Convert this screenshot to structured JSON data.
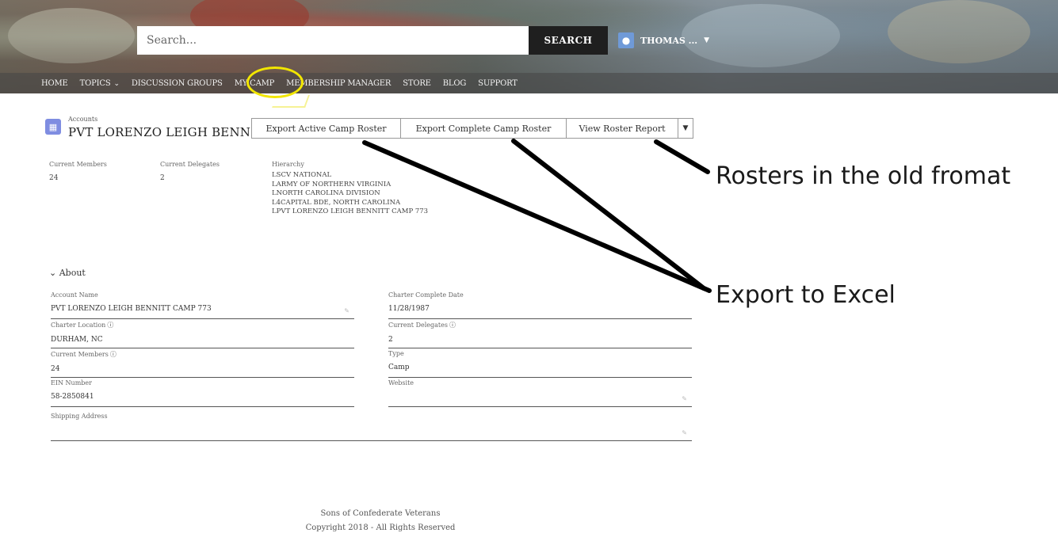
{
  "header": {
    "search_placeholder": "Search...",
    "search_button": "SEARCH",
    "user_name": "THOMAS ...",
    "nav": [
      {
        "label": "HOME"
      },
      {
        "label": "TOPICS",
        "has_dropdown": true
      },
      {
        "label": "DISCUSSION GROUPS"
      },
      {
        "label": "MY CAMP"
      },
      {
        "label": "MEMBERSHIP MANAGER"
      },
      {
        "label": "STORE"
      },
      {
        "label": "BLOG"
      },
      {
        "label": "SUPPORT"
      }
    ],
    "highlight_color": "#f2e600"
  },
  "record": {
    "object_label": "Accounts",
    "title": "PVT LORENZO LEIGH BENNIT...",
    "actions": {
      "export_active": "Export Active Camp Roster",
      "export_complete": "Export Complete Camp Roster",
      "view_roster": "View Roster Report",
      "more_icon": "chevron-down-icon"
    }
  },
  "highlights": {
    "current_members_label": "Current Members",
    "current_members_value": "24",
    "current_delegates_label": "Current Delegates",
    "current_delegates_value": "2",
    "hierarchy_label": "Hierarchy",
    "hierarchy": [
      "LSCV NATIONAL",
      "LARMY OF NORTHERN VIRGINIA",
      "LNORTH CAROLINA DIVISION",
      "L4CAPITAL BDE, NORTH CAROLINA",
      "LPVT LORENZO LEIGH BENNITT CAMP 773"
    ]
  },
  "about": {
    "heading": "About",
    "fields": {
      "account_name": {
        "label": "Account Name",
        "value": "PVT LORENZO LEIGH BENNITT CAMP 773"
      },
      "charter_complete_date": {
        "label": "Charter Complete Date",
        "value": "11/28/1987"
      },
      "charter_location": {
        "label": "Charter Location",
        "value": "DURHAM, NC"
      },
      "current_delegates": {
        "label": "Current Delegates",
        "value": "2"
      },
      "current_members": {
        "label": "Current Members",
        "value": "24"
      },
      "type": {
        "label": "Type",
        "value": "Camp"
      },
      "ein_number": {
        "label": "EIN Number",
        "value": "58-2850841"
      },
      "website": {
        "label": "Website",
        "value": ""
      },
      "shipping_address": {
        "label": "Shipping Address",
        "value": ""
      }
    }
  },
  "annotations": {
    "rosters_old_format": "Rosters in the old fromat",
    "export_to_excel": "Export to Excel"
  },
  "footer": {
    "org": "Sons of Confederate Veterans",
    "copyright": "Copyright 2018 - All Rights Reserved"
  }
}
